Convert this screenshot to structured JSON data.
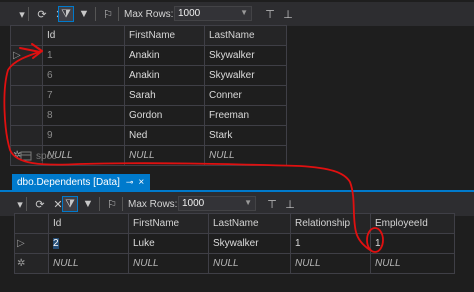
{
  "top_toolbar": {
    "max_rows_label": "Max Rows:",
    "max_rows_value": "1000"
  },
  "top_grid": {
    "columns": [
      "Id",
      "FirstName",
      "LastName"
    ],
    "rows": [
      {
        "id": "1",
        "first": "Anakin",
        "last": "Skywalker"
      },
      {
        "id": "6",
        "first": "Anakin",
        "last": "Skywalker"
      },
      {
        "id": "7",
        "first": "Sarah",
        "last": "Conner"
      },
      {
        "id": "8",
        "first": "Gordon",
        "last": "Freeman"
      },
      {
        "id": "9",
        "first": "Ned",
        "last": "Stark"
      }
    ],
    "new_row": {
      "id": "NULL",
      "first": "NULL",
      "last": "NULL"
    }
  },
  "faded_tab_label": "spcc",
  "tab": {
    "label": "dbo.Dependents [Data]",
    "pin_icon": "⊸",
    "close_icon": "×"
  },
  "bottom_toolbar": {
    "max_rows_label": "Max Rows:",
    "max_rows_value": "1000"
  },
  "bottom_grid": {
    "columns": [
      "Id",
      "FirstName",
      "LastName",
      "Relationship",
      "EmployeeId"
    ],
    "row": {
      "id": "2",
      "first": "Luke",
      "last": "Skywalker",
      "relationship": "1",
      "employee_id": "1"
    },
    "new_row": {
      "id": "NULL",
      "first": "NULL",
      "last": "NULL",
      "relationship": "NULL",
      "employee_id": "NULL"
    }
  },
  "colors": {
    "accent": "#007acc",
    "annotation_red": "#e01010",
    "background": "#1e1e1e"
  }
}
